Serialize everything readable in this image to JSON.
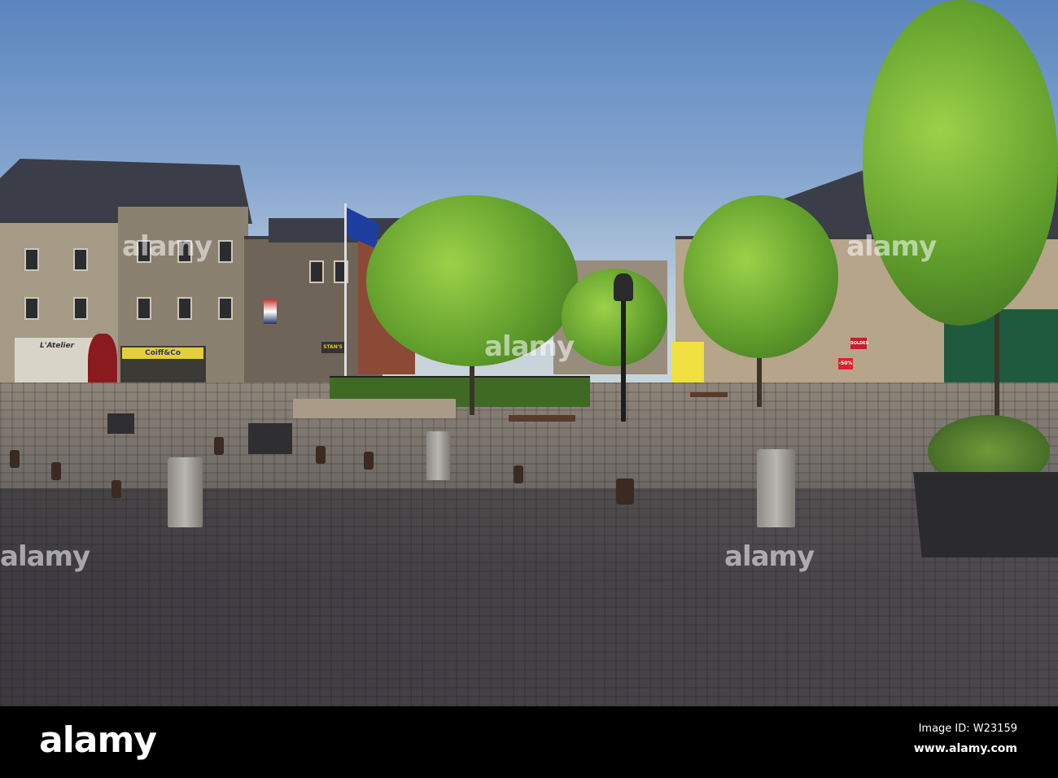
{
  "photo": {
    "description_alt": "Cobblestone town square with trees and stone buildings",
    "shop_signs": [
      "L'Atelier",
      "Coiff&Co",
      "STAN'S",
      "SOLDES",
      "-50%"
    ],
    "watermark": "alamy"
  },
  "footer": {
    "logo": "alamy",
    "image_id": "Image ID: W23159",
    "url": "www.alamy.com"
  },
  "colors": {
    "sky": "#6f95c8",
    "foliage": "#7cbf3a",
    "footer": "#000000"
  }
}
